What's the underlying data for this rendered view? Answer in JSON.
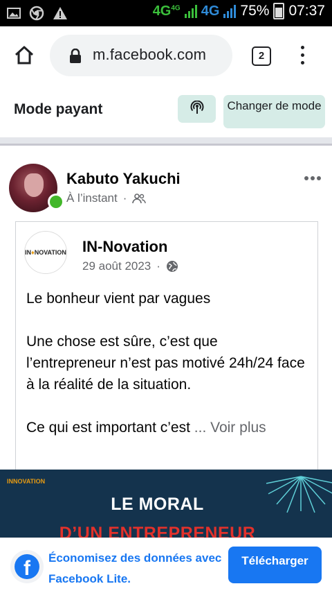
{
  "status_bar": {
    "network1": "4G",
    "network1_sup": "4G",
    "network2": "4G",
    "battery": "75%",
    "time": "07:37",
    "left_icons": [
      "gallery-icon",
      "chrome-icon",
      "warning-icon"
    ]
  },
  "browser": {
    "url": "m.facebook.com",
    "tab_count": "2"
  },
  "mode_bar": {
    "title": "Mode payant",
    "change_button": "Changer de mode"
  },
  "post": {
    "author": "Kabuto Yakuchi",
    "time": "À l’instant",
    "audience_icon": "friends-icon",
    "shared": {
      "page_name": "IN-Novation",
      "logo_text_a": "IN",
      "logo_text_b": "NOVATION",
      "date": "29 août 2023",
      "audience_icon": "globe-icon",
      "paragraphs": [
        "Le bonheur vient par vagues",
        "Une chose est sûre, c’est que l’entrepreneur n’est pas motivé 24h/24 face à la réalité de la situation.",
        "Ce qui est important c’est"
      ],
      "see_more": "... Voir plus"
    },
    "image": {
      "logo_text": "INNOVATION",
      "title": "LE MORAL",
      "subtitle": "D’UN ENTREPRENEUR"
    }
  },
  "banner": {
    "text": "Économisez des données avec Facebook Lite.",
    "button": "Télécharger"
  },
  "colors": {
    "facebook_blue": "#1877f2",
    "mode_button_bg": "#d6ece7",
    "online_green": "#42b72a",
    "preview_bg": "#14334d"
  }
}
